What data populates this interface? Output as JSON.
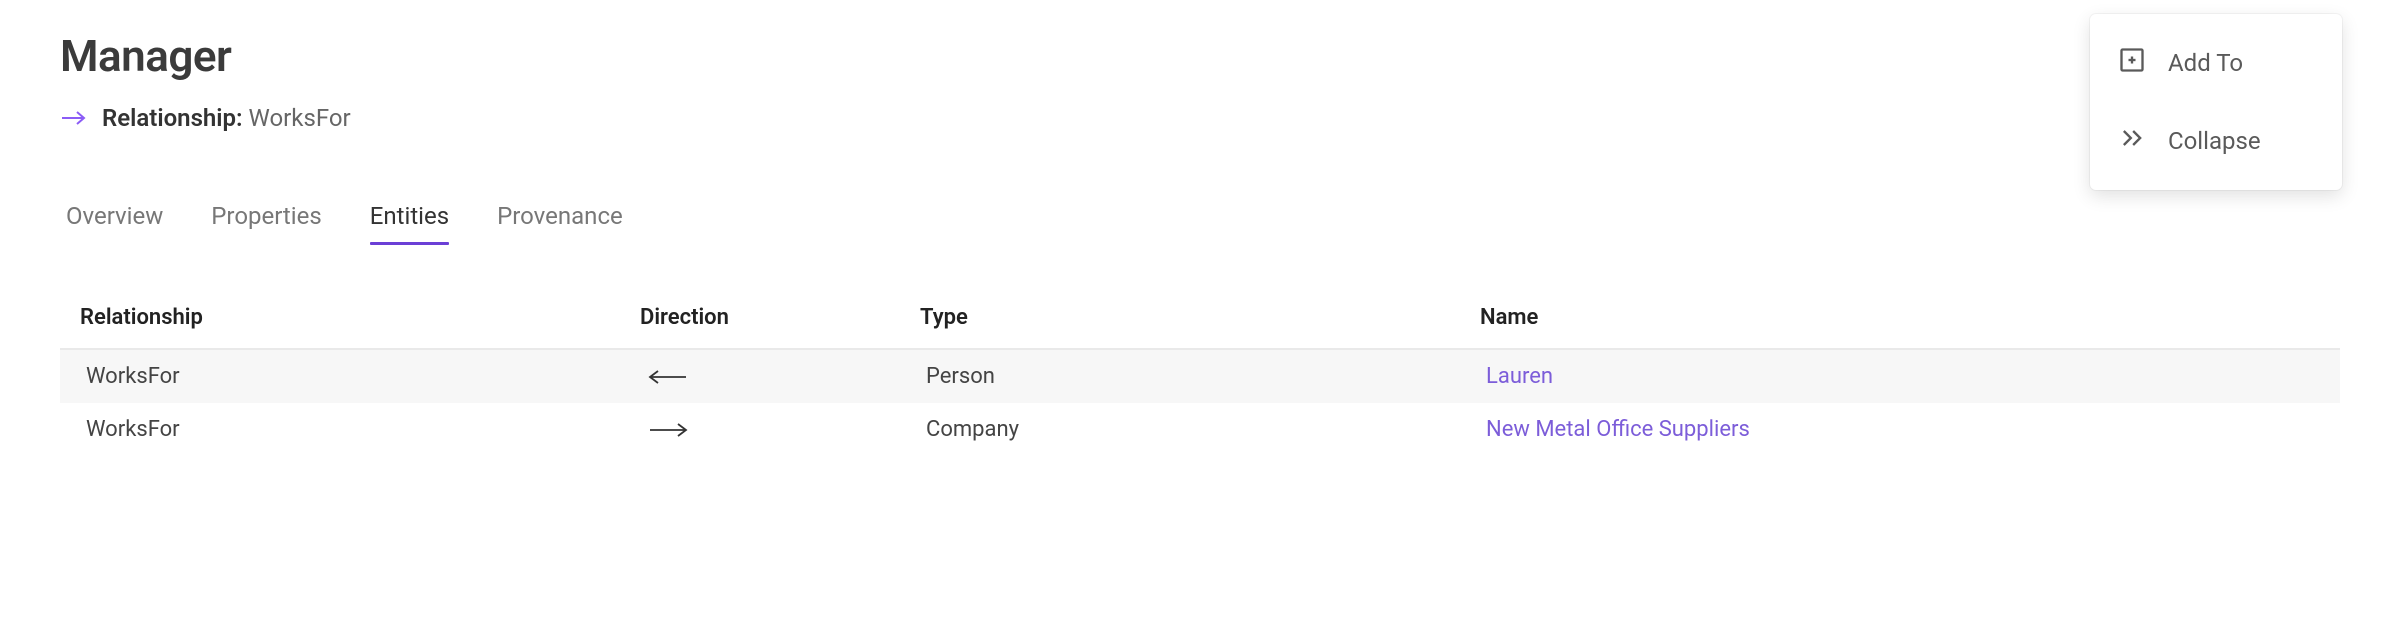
{
  "header": {
    "title": "Manager",
    "relationship_label": "Relationship:",
    "relationship_value": "WorksFor"
  },
  "tabs": [
    {
      "label": "Overview",
      "active": false
    },
    {
      "label": "Properties",
      "active": false
    },
    {
      "label": "Entities",
      "active": true
    },
    {
      "label": "Provenance",
      "active": false
    }
  ],
  "table": {
    "columns": [
      "Relationship",
      "Direction",
      "Type",
      "Name"
    ],
    "rows": [
      {
        "relationship": "WorksFor",
        "direction": "left",
        "type": "Person",
        "name": "Lauren"
      },
      {
        "relationship": "WorksFor",
        "direction": "right",
        "type": "Company",
        "name": "New Metal Office Suppliers"
      }
    ]
  },
  "menu": {
    "add_to": "Add To",
    "collapse": "Collapse"
  }
}
